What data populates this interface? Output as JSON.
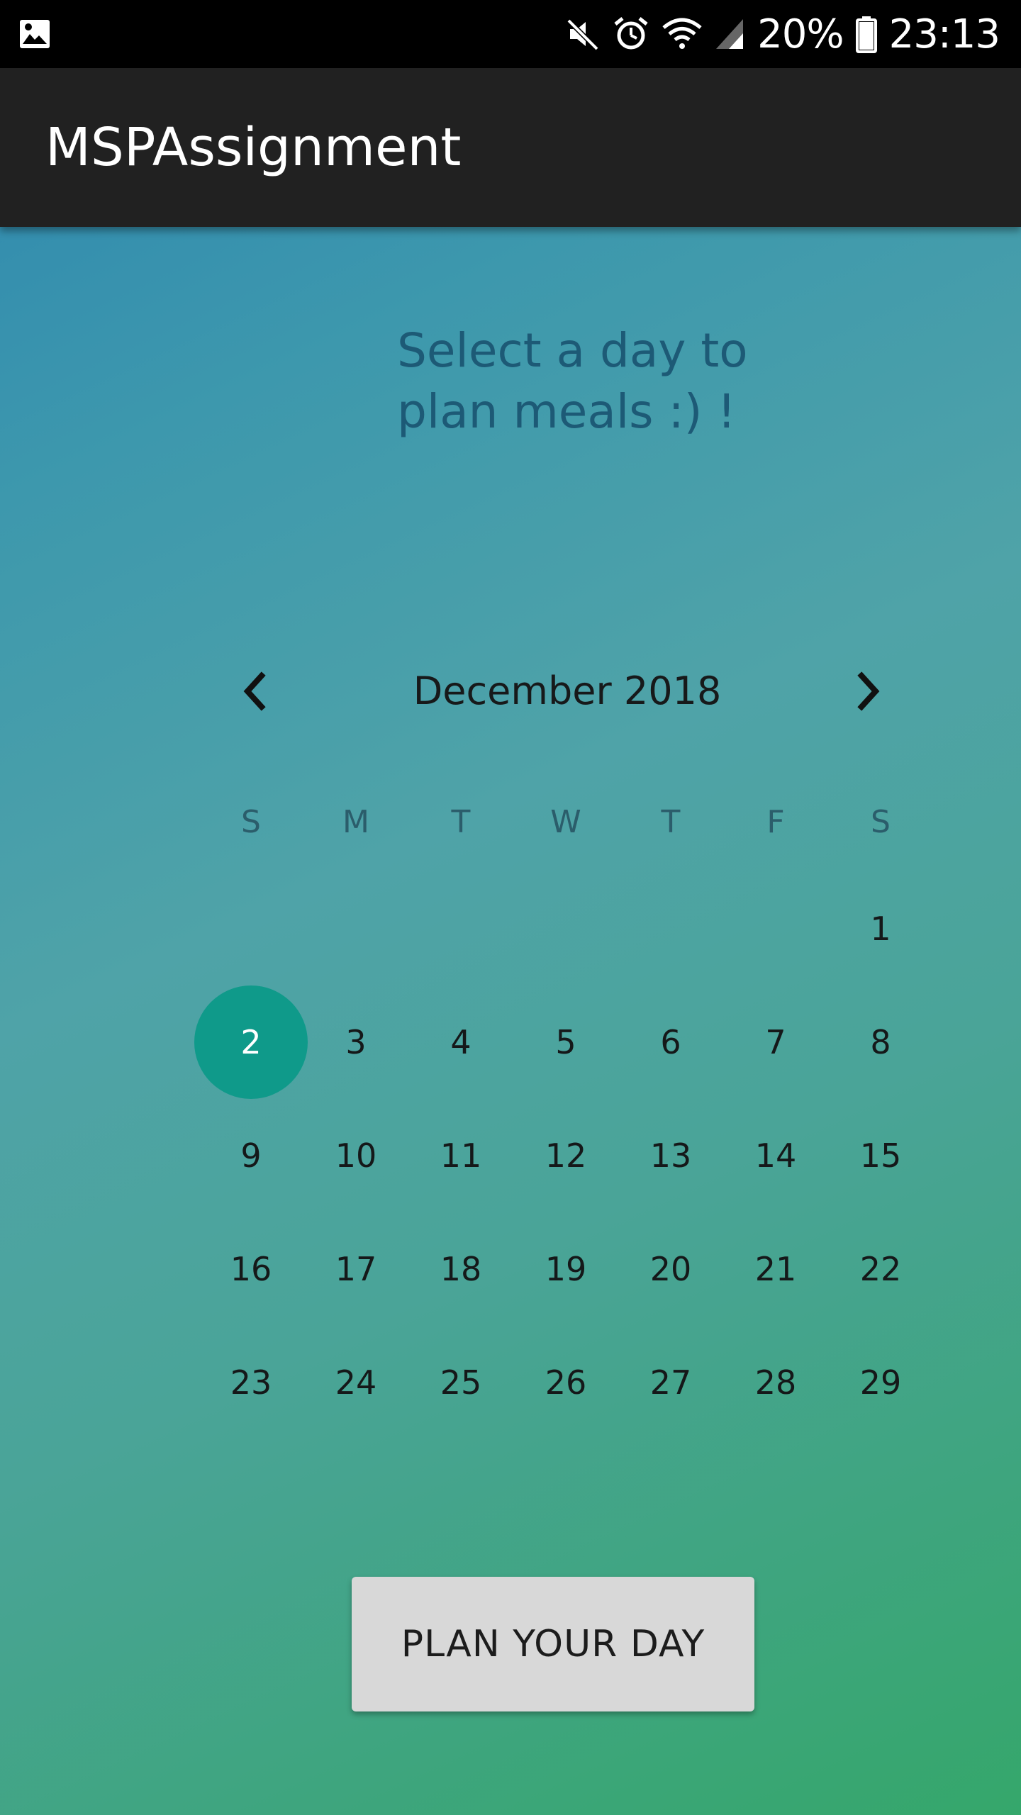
{
  "status_bar": {
    "battery_percent": "20%",
    "time": "23:13",
    "icons": [
      "gallery-icon",
      "mute-icon",
      "alarm-icon",
      "wifi-icon",
      "signal-icon",
      "battery-icon"
    ]
  },
  "app_bar": {
    "title": "MSPAssignment",
    "background": "#212121"
  },
  "prompt": {
    "line1": "Select a day to",
    "line2": "plan meals :) !"
  },
  "calendar": {
    "month_label": "December 2018",
    "prev_icon": "chevron-left-icon",
    "next_icon": "chevron-right-icon",
    "weekdays": [
      "S",
      "M",
      "T",
      "W",
      "T",
      "F",
      "S"
    ],
    "leading_blanks": 6,
    "days": [
      "1",
      "2",
      "3",
      "4",
      "5",
      "6",
      "7",
      "8",
      "9",
      "10",
      "11",
      "12",
      "13",
      "14",
      "15",
      "16",
      "17",
      "18",
      "19",
      "20",
      "21",
      "22",
      "23",
      "24",
      "25",
      "26",
      "27",
      "28",
      "29"
    ],
    "selected_day": "2",
    "selected_color": "#0f9a8a"
  },
  "button": {
    "label": "PLAN YOUR DAY"
  }
}
